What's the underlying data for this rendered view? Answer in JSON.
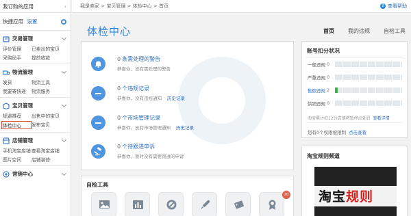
{
  "sidebar": {
    "top_label": "我订购的应用",
    "quick_label": "快捷应用",
    "quick_setting": "设置",
    "groups": [
      {
        "title": "交易管理",
        "icon": "transaction-icon",
        "links": [
          "评价管理",
          "已卖出的宝贝",
          "采购助手",
          "提前收款"
        ]
      },
      {
        "title": "物流管理",
        "icon": "logistics-icon",
        "links": [
          "发货",
          "物流工具",
          "我要寄快递",
          "物流服务"
        ]
      },
      {
        "title": "宝贝管理",
        "icon": "goods-icon",
        "links": [
          "规避推荐",
          "出售中的宝贝",
          "体检中心",
          "发布宝贝"
        ],
        "active": "体检中心"
      },
      {
        "title": "店铺管理",
        "icon": "shop-icon",
        "links": [
          "手机淘宝店铺",
          "查看淘宝店铺",
          "图片空间",
          "店铺装修"
        ]
      },
      {
        "title": "营销中心",
        "icon": "marketing-icon",
        "links": []
      }
    ]
  },
  "breadcrumb": {
    "items": [
      "我是卖家",
      "宝贝管理",
      "体检中心",
      "首页"
    ],
    "separator": " > "
  },
  "help_label": "查看帮助",
  "page_title": "体检中心",
  "tabs": [
    "首页",
    "我的违规",
    "自检工具"
  ],
  "active_tab": "首页",
  "records": [
    {
      "count": "0",
      "title": "条需处理的警告",
      "subtitle": "恭喜你，没有需处理的警告",
      "link": "",
      "icon": "bell-icon"
    },
    {
      "count": "0",
      "title": "个违规记录",
      "subtitle": "恭喜你，没有违规通知",
      "link": "历史记录",
      "icon": "minus-circle-icon"
    },
    {
      "count": "0",
      "title": "个市场管理记录",
      "subtitle": "恭喜你，没有市场管理通知",
      "link": "历史记录",
      "icon": "minus-circle-icon"
    },
    {
      "count": "0",
      "title": "个待跟进申诉",
      "subtitle": "恭喜你，暂时没有需要跟进的申诉",
      "link": "",
      "icon": "gavel-icon"
    }
  ],
  "account": {
    "title": "账号扣分状况",
    "rows": [
      {
        "label": "一般违规",
        "value": "0",
        "fill_fraction": 0
      },
      {
        "label": "严重违规",
        "value": "0",
        "fill_fraction": 0
      },
      {
        "label": "售假违规",
        "value": "2",
        "fill_fraction": 0.04
      },
      {
        "label": "供销违规",
        "value": "0",
        "fill_fraction": 0
      }
    ],
    "note": "淘宝累计扣12分店铺将暂停点处罚",
    "note_link": "查看详情",
    "privilege_text": "您有0个权限被限制",
    "privilege_link": "点击查看",
    "fill_color": "#3bb54a"
  },
  "rules": {
    "title": "淘宝规则频道",
    "logo_text_black": "淘宝",
    "logo_text_red": "规则"
  },
  "tools": {
    "title": "自检工具",
    "icons": [
      "image-check-icon",
      "chart-check-icon",
      "forbidden-check-icon",
      "syringe-icon",
      "price-tag-icon",
      "badge-icon"
    ],
    "badge_count": "20"
  },
  "colors": {
    "accent": "#2f7ed8",
    "icon_blue": "#4f95e0",
    "alert_red": "#e0463a"
  }
}
